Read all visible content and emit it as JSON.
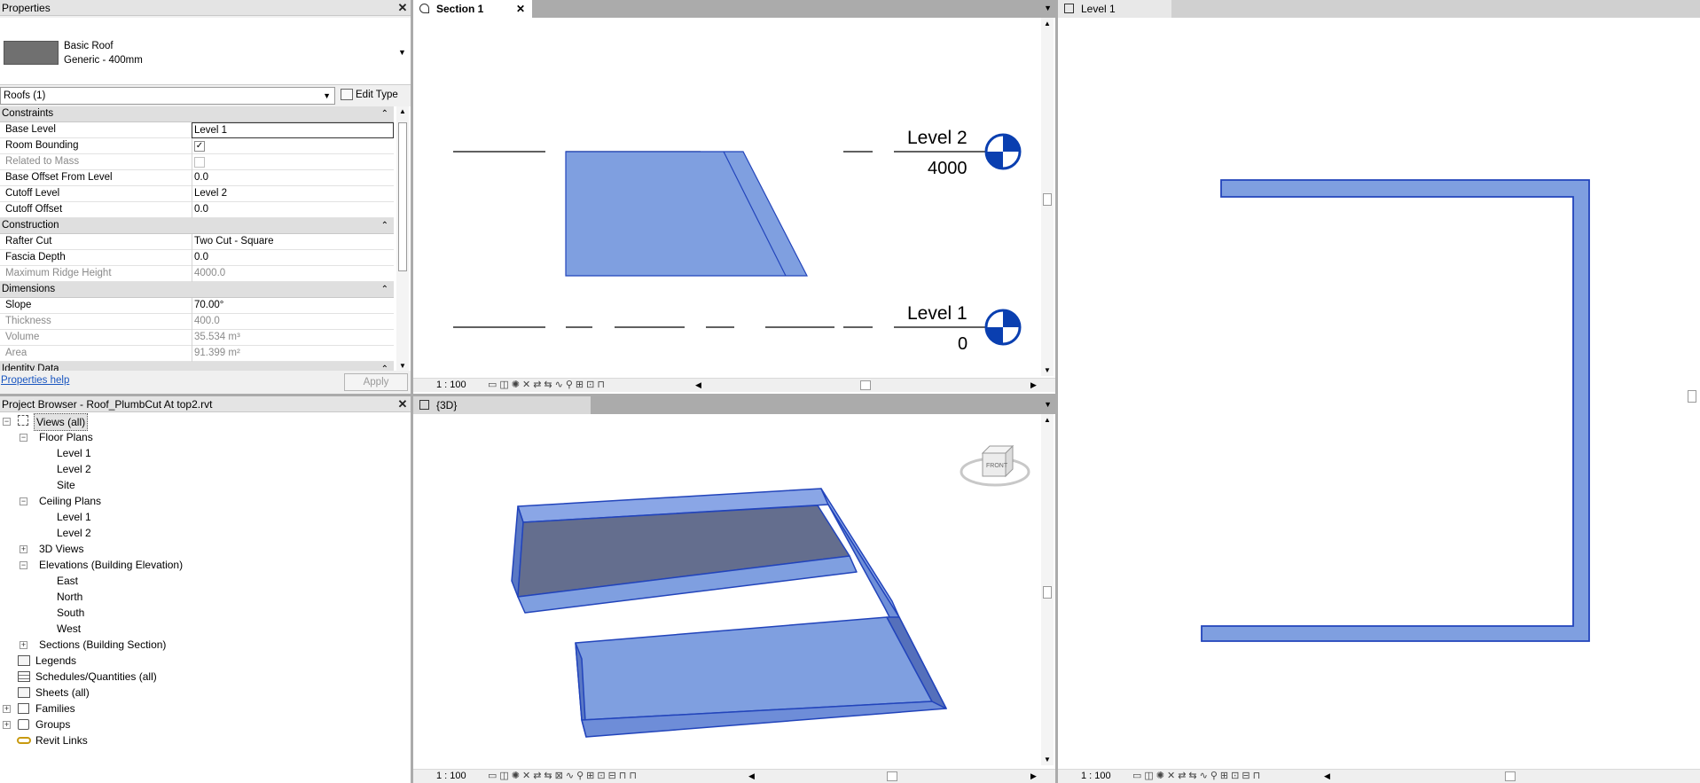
{
  "properties": {
    "title": "Properties",
    "type_name": "Basic Roof",
    "type_sub": "Generic - 400mm",
    "selector": "Roofs (1)",
    "edit_type": "Edit Type",
    "cat_constraints": "Constraints",
    "constraints": [
      {
        "k": "Base Level",
        "v": "Level 1",
        "grey": false
      },
      {
        "k": "Room Bounding",
        "v": "",
        "grey": false
      },
      {
        "k": "Related to Mass",
        "v": "",
        "grey": true
      },
      {
        "k": "Base Offset From Level",
        "v": "0.0",
        "grey": false
      },
      {
        "k": "Cutoff Level",
        "v": "Level 2",
        "grey": false
      },
      {
        "k": "Cutoff Offset",
        "v": "0.0",
        "grey": false
      }
    ],
    "cat_construction": "Construction",
    "construction": [
      {
        "k": "Rafter Cut",
        "v": "Two Cut - Square",
        "grey": false
      },
      {
        "k": "Fascia Depth",
        "v": "0.0",
        "grey": false
      },
      {
        "k": "Maximum Ridge Height",
        "v": "4000.0",
        "grey": true
      }
    ],
    "cat_dimensions": "Dimensions",
    "dimensions": [
      {
        "k": "Slope",
        "v": "70.00°",
        "grey": false
      },
      {
        "k": "Thickness",
        "v": "400.0",
        "grey": true
      },
      {
        "k": "Volume",
        "v": "35.534 m³",
        "grey": true
      },
      {
        "k": "Area",
        "v": "91.399 m²",
        "grey": true
      }
    ],
    "cat_identity": "Identity Data",
    "help": "Properties help",
    "apply": "Apply"
  },
  "browser": {
    "title": "Project Browser - Roof_PlumbCut At top2.rvt",
    "views_all": "Views (all)",
    "floor_plans": "Floor Plans",
    "fp_items": [
      "Level 1",
      "Level 2",
      "Site"
    ],
    "ceiling_plans": "Ceiling Plans",
    "cp_items": [
      "Level 1",
      "Level 2"
    ],
    "views_3d": "3D Views",
    "elevations": "Elevations (Building Elevation)",
    "elev_items": [
      "East",
      "North",
      "South",
      "West"
    ],
    "sections": "Sections (Building Section)",
    "legends": "Legends",
    "schedules": "Schedules/Quantities (all)",
    "sheets": "Sheets (all)",
    "families": "Families",
    "groups": "Groups",
    "revit_links": "Revit Links"
  },
  "section_view": {
    "tab": "Section 1",
    "level2_name": "Level 2",
    "level2_elev": "4000",
    "level1_name": "Level 1",
    "level1_elev": "0",
    "scale": "1 : 100"
  },
  "view_3d": {
    "tab": "{3D}",
    "cube_face": "FRONT",
    "scale": "1 : 100"
  },
  "plan_view": {
    "tab": "Level 1",
    "scale": "1 : 100"
  },
  "colors": {
    "roof_fill": "#7f9fe0",
    "roof_stroke": "#2244bb",
    "level_head": "#0a3fb0"
  }
}
